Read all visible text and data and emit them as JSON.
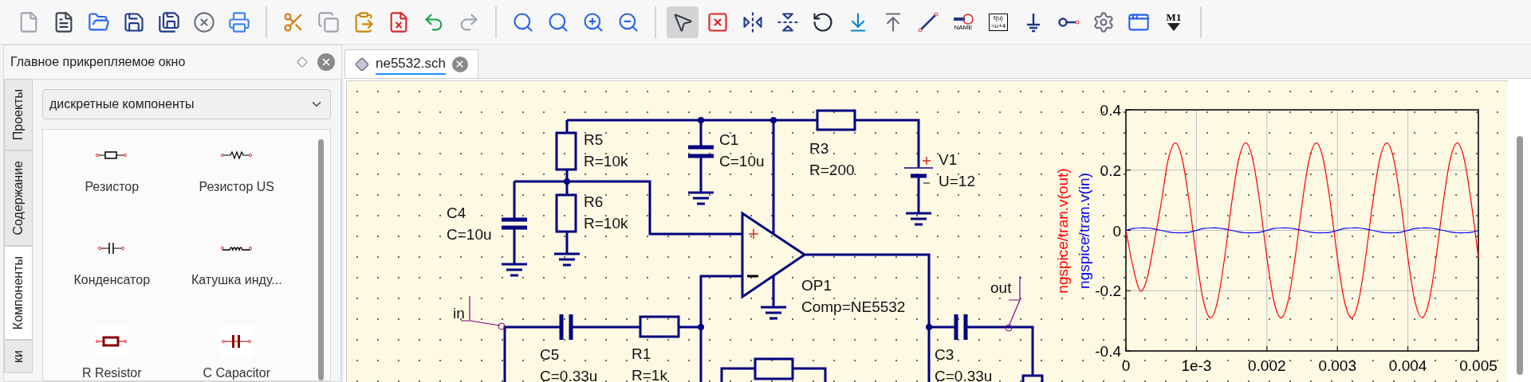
{
  "toolbar": {
    "mode_tools": [
      {
        "selected": true
      },
      {
        "selected": false
      },
      {
        "selected": false
      },
      {
        "selected": false
      },
      {
        "selected": false
      },
      {
        "selected": false
      },
      {
        "selected": false
      },
      {
        "selected": false
      },
      {
        "selected": false,
        "label": "NAME"
      },
      {
        "selected": false,
        "lines": [
          "f(u)",
          "=u+4"
        ]
      },
      {
        "selected": false
      },
      {
        "selected": false
      },
      {
        "selected": false
      },
      {
        "selected": false
      },
      {
        "selected": false,
        "label": "M1"
      }
    ]
  },
  "dock": {
    "title": "Главное прикрепляемое окно",
    "side_tabs": [
      {
        "label": "Проекты",
        "selected": false
      },
      {
        "label": "Содержание",
        "selected": false
      },
      {
        "label": "Компоненты",
        "selected": true
      },
      {
        "label": "ки",
        "selected": false
      }
    ],
    "category": {
      "value": "дискретные компоненты"
    },
    "components": [
      {
        "kind": "resistor",
        "label": "Резистор"
      },
      {
        "kind": "resistor_us",
        "label": "Резистор US"
      },
      {
        "kind": "capacitor",
        "label": "Конденсатор"
      },
      {
        "kind": "inductor",
        "label": "Катушка инду..."
      },
      {
        "kind": "r_resistor",
        "label": "R Resistor"
      },
      {
        "kind": "c_capacitor",
        "label": "C Capacitor"
      }
    ]
  },
  "document_tabs": [
    {
      "label": "ne5532.sch",
      "selected": true
    }
  ],
  "schematic": {
    "parts": [
      {
        "name": "R5",
        "value": "R=10k"
      },
      {
        "name": "C1",
        "value": "C=10u"
      },
      {
        "name": "R6",
        "value": "R=10k"
      },
      {
        "name": "C4",
        "value": "C=10u"
      },
      {
        "name": "R3",
        "value": "R=200"
      },
      {
        "name": "V1",
        "value": "U=12"
      },
      {
        "name": "OP1",
        "value": "Comp=NE5532"
      },
      {
        "name": "C5",
        "value": "C=0.33u"
      },
      {
        "name": "R1",
        "value": "R=1k"
      },
      {
        "name": "C3",
        "value": "C=0.33u"
      }
    ],
    "nets": [
      {
        "label": "in"
      },
      {
        "label": "out"
      }
    ],
    "chart_data": {
      "type": "line",
      "x": [
        0,
        0.0001,
        0.0002,
        0.0003,
        0.0004,
        0.0005,
        0.0006,
        0.0007,
        0.0008,
        0.0009,
        0.001,
        0.0011,
        0.0012,
        0.0013,
        0.0014,
        0.0015,
        0.0016,
        0.0017,
        0.0018,
        0.0019,
        0.002,
        0.0021,
        0.0022,
        0.0023,
        0.0024,
        0.0025,
        0.0026,
        0.0027,
        0.0028,
        0.0029,
        0.003,
        0.0031,
        0.0032,
        0.0033,
        0.0034,
        0.0035,
        0.0036,
        0.0037,
        0.0038,
        0.0039,
        0.004,
        0.0041,
        0.0042,
        0.0043,
        0.0044,
        0.0045,
        0.0046,
        0.0047,
        0.0048,
        0.0049,
        0.005
      ],
      "series": [
        {
          "name": "ngspice/tran.v(out)",
          "color": "#ff0000",
          "values": [
            0,
            -0.12,
            -0.2,
            -0.16,
            -0.04,
            0.09,
            0.235,
            0.29,
            0.235,
            0.09,
            -0.09,
            -0.235,
            -0.29,
            -0.235,
            -0.09,
            0.09,
            0.235,
            0.29,
            0.235,
            0.09,
            -0.09,
            -0.235,
            -0.29,
            -0.235,
            -0.09,
            0.09,
            0.235,
            0.29,
            0.235,
            0.09,
            -0.09,
            -0.235,
            -0.29,
            -0.235,
            -0.09,
            0.09,
            0.235,
            0.29,
            0.235,
            0.09,
            -0.09,
            -0.235,
            -0.29,
            -0.235,
            -0.09,
            0.09,
            0.235,
            0.29,
            0.235,
            0.09,
            -0.09
          ]
        },
        {
          "name": "ngspice/tran.v(in)",
          "color": "#0000ff",
          "values": [
            0,
            0.006,
            0.008,
            0.008,
            0.005,
            0,
            -0.005,
            -0.008,
            -0.008,
            -0.006,
            0,
            0.006,
            0.008,
            0.008,
            0.005,
            0,
            -0.005,
            -0.008,
            -0.008,
            -0.006,
            0,
            0.006,
            0.008,
            0.008,
            0.005,
            0,
            -0.005,
            -0.008,
            -0.008,
            -0.006,
            0,
            0.006,
            0.008,
            0.008,
            0.005,
            0,
            -0.005,
            -0.008,
            -0.008,
            -0.006,
            0,
            0.006,
            0.008,
            0.008,
            0.005,
            0,
            -0.005,
            -0.008,
            -0.008,
            -0.006,
            0
          ]
        }
      ],
      "xlim": [
        0,
        0.005
      ],
      "ylim": [
        -0.4,
        0.4
      ],
      "xticks": [
        0,
        {
          "value": 0.001,
          "label": "1e-3"
        },
        0.002,
        0.003,
        0.004,
        0.005
      ],
      "yticks": [
        -0.4,
        -0.2,
        0,
        0.2,
        0.4
      ],
      "grid": true
    }
  }
}
